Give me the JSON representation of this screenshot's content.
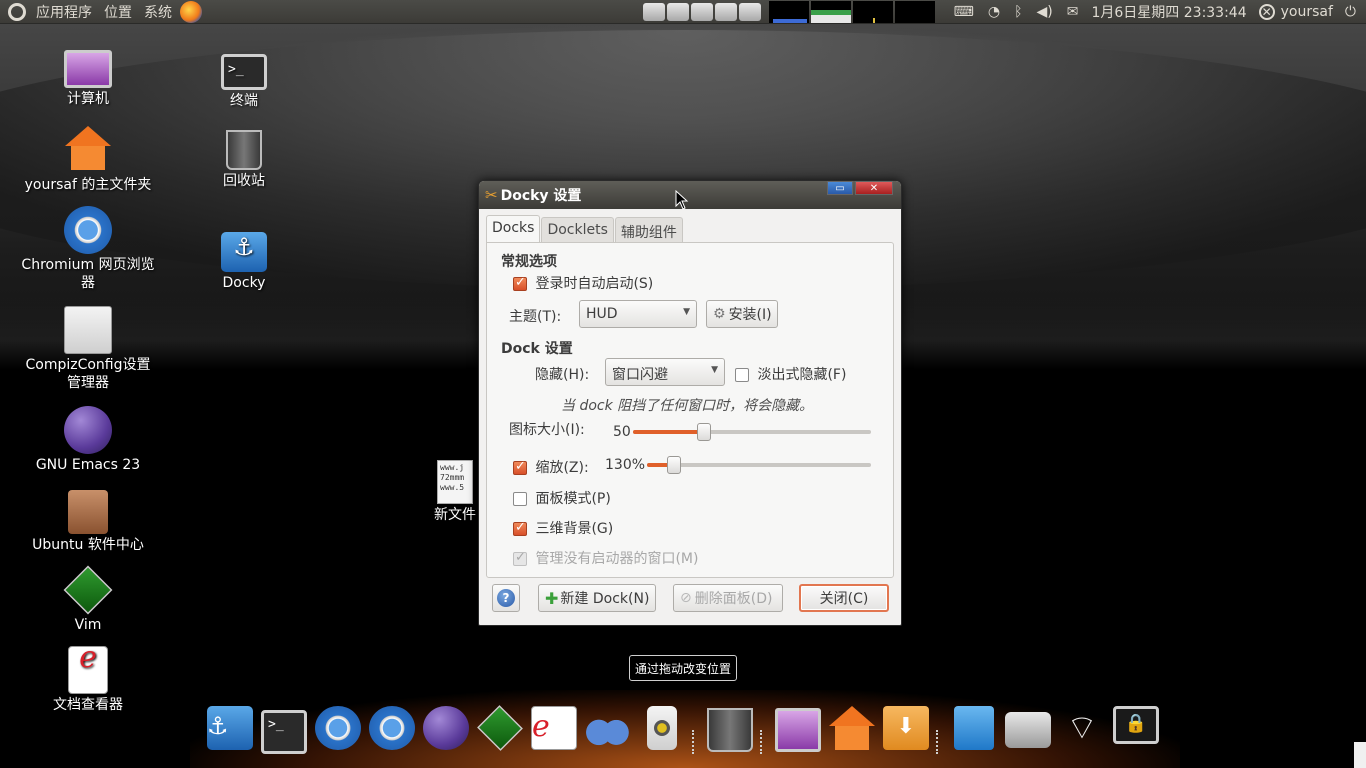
{
  "top_panel": {
    "menus": [
      "应用程序",
      "位置",
      "系统"
    ],
    "clock": "1月6日星期四 23:33:44",
    "user": "yoursaf"
  },
  "desktop_icons": [
    {
      "label": "计算机",
      "icon": "computer-icon"
    },
    {
      "label": "yoursaf 的主文件夹",
      "icon": "home-folder-icon"
    },
    {
      "label": "Chromium 网页浏览器",
      "icon": "chromium-icon"
    },
    {
      "label": "CompizConfig设置管理器",
      "icon": "compizconfig-icon"
    },
    {
      "label": "GNU Emacs 23",
      "icon": "emacs-icon"
    },
    {
      "label": "Ubuntu 软件中心",
      "icon": "software-center-icon"
    },
    {
      "label": "Vim",
      "icon": "vim-icon"
    },
    {
      "label": "文档查看器",
      "icon": "document-viewer-icon"
    },
    {
      "label": "终端",
      "icon": "terminal-icon"
    },
    {
      "label": "回收站",
      "icon": "trash-icon"
    },
    {
      "label": "Docky",
      "icon": "docky-icon"
    },
    {
      "label": "新文件",
      "icon": "text-file-icon",
      "preview": [
        "www.j",
        "72mmm",
        "www.5"
      ]
    }
  ],
  "dialog": {
    "title": "Docky 设置",
    "tabs": [
      "Docks",
      "Docklets",
      "辅助组件"
    ],
    "general_section": "常规选项",
    "autostart_label": "登录时自动启动(S)",
    "autostart_checked": true,
    "theme_label": "主题(T):",
    "theme_value": "HUD",
    "install_button": "安装(I)",
    "dock_section": "Dock 设置",
    "hide_label": "隐藏(H):",
    "hide_value": "窗口闪避",
    "fade_hide_label": "淡出式隐藏(F)",
    "fade_hide_checked": false,
    "hide_hint": "当 dock 阻挡了任何窗口时，将会隐藏。",
    "icon_size_label": "图标大小(I):",
    "icon_size_value": "50",
    "icon_size_fraction": 0.3,
    "zoom_label": "缩放(Z):",
    "zoom_checked": true,
    "zoom_value": "130%",
    "zoom_fraction": 0.12,
    "panel_mode_label": "面板模式(P)",
    "panel_mode_checked": false,
    "threed_label": "三维背景(G)",
    "threed_checked": true,
    "manage_windows_label": "管理没有启动器的窗口(M)",
    "new_dock_button": "新建 Dock(N)",
    "delete_panel_button": "删除面板(D)",
    "close_button": "关闭(C)"
  },
  "tooltip": "通过拖动改变位置",
  "dock_items": [
    "docky-icon",
    "terminal-icon",
    "chromium-icon",
    "chromium-icon",
    "emacs-icon",
    "vim-icon",
    "document-viewer-icon",
    "feet-icon",
    "speaker-icon",
    "trash-icon",
    "computer-icon",
    "home-folder-icon",
    "downloads-folder-icon",
    "blue-folder-icon",
    "drive-icon",
    "wifi-icon",
    "lock-screen-icon"
  ]
}
